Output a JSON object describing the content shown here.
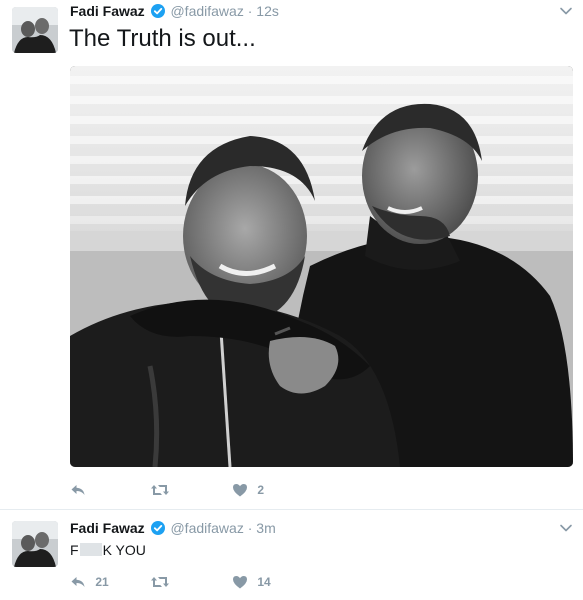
{
  "tweets": [
    {
      "author_name": "Fadi Fawaz",
      "handle": "@fadifawaz",
      "separator": "·",
      "time": "12s",
      "text": "The Truth is out...",
      "reply_count": "",
      "retweet_count": "",
      "like_count": "2"
    },
    {
      "author_name": "Fadi Fawaz",
      "handle": "@fadifawaz",
      "separator": "·",
      "time": "3m",
      "text_prefix": "F",
      "text_suffix": "K YOU",
      "reply_count": "21",
      "retweet_count": "",
      "like_count": "14"
    }
  ],
  "colors": {
    "verified": "#1da1f2",
    "secondary_text": "#8899a6",
    "primary_text": "#14171a",
    "divider": "#e6ecf0"
  },
  "icons": {
    "verified": "verified-badge-icon",
    "menu": "chevron-down-icon",
    "reply": "reply-icon",
    "retweet": "retweet-icon",
    "like": "heart-icon"
  }
}
